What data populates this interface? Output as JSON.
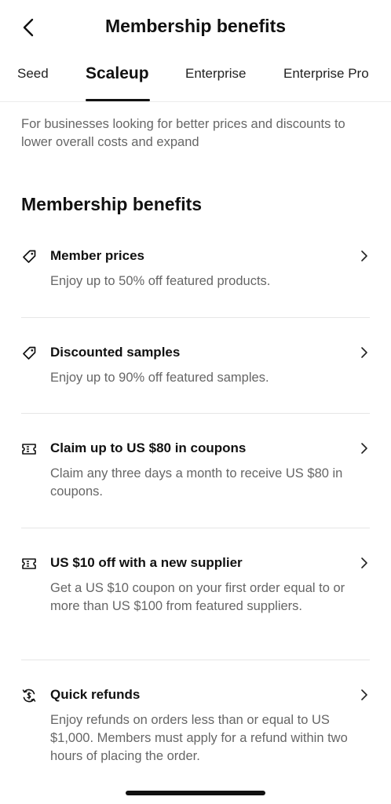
{
  "header": {
    "title": "Membership benefits"
  },
  "tabs": [
    {
      "label": "Seed"
    },
    {
      "label": "Scaleup"
    },
    {
      "label": "Enterprise"
    },
    {
      "label": "Enterprise Pro"
    }
  ],
  "intro": "For businesses looking for better prices and discounts to lower overall costs and expand",
  "section_title": "Membership benefits",
  "benefits": [
    {
      "icon": "tag-icon",
      "title": "Member prices",
      "description": "Enjoy up to 50% off featured products."
    },
    {
      "icon": "tag-icon",
      "title": "Discounted samples",
      "description": "Enjoy up to 90% off featured samples."
    },
    {
      "icon": "coupon-icon",
      "title": "Claim up to US $80 in coupons",
      "description": "Claim any three days a month to receive US $80 in coupons."
    },
    {
      "icon": "coupon-icon",
      "title": "US $10 off with a new supplier",
      "description": "Get a US $10 coupon on your first order equal to or more than US $100 from featured suppliers."
    },
    {
      "icon": "refund-icon",
      "title": "Quick refunds",
      "description": "Enjoy refunds on orders less than or equal to US $1,000. Members must apply for a refund within two hours of placing the order."
    }
  ]
}
